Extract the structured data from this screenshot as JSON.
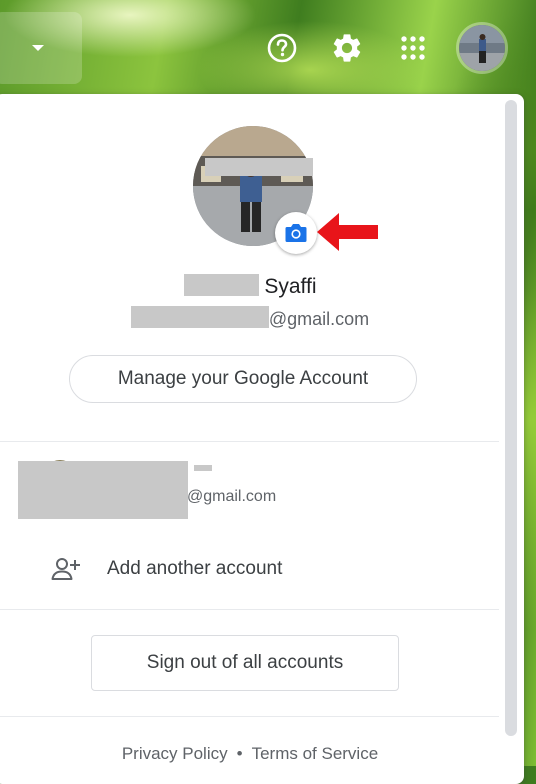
{
  "header": {
    "icons": [
      "chevron-down-icon",
      "help-icon",
      "gear-icon",
      "apps-grid-icon",
      "avatar"
    ]
  },
  "account": {
    "name_visible": "Syaffi",
    "email_suffix": "@gmail.com",
    "manage_label": "Manage your Google Account"
  },
  "other_account": {
    "email_suffix": "@gmail.com"
  },
  "add_account_label": "Add another account",
  "signout_label": "Sign out of all accounts",
  "footer": {
    "privacy": "Privacy Policy",
    "separator": "•",
    "terms": "Terms of Service"
  },
  "colors": {
    "camera_blue": "#1a73e8",
    "arrow_red": "#e8141a",
    "redaction_gray": "#c8c8c8"
  }
}
